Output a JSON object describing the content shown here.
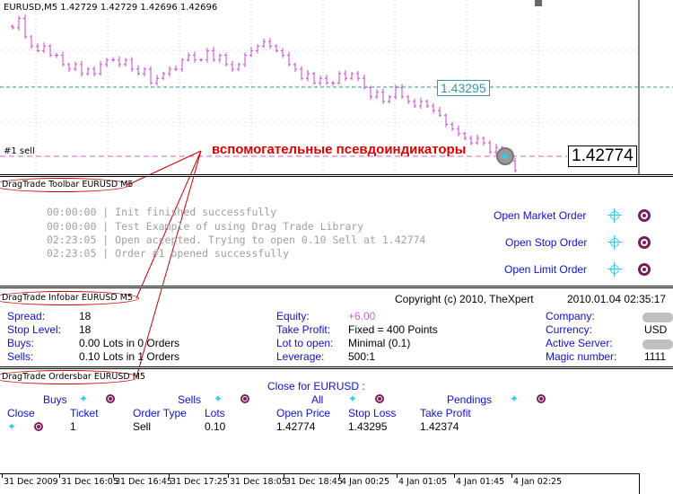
{
  "chart": {
    "header": "EURUSD,M5  1.42729 1.42729 1.42696 1.42696",
    "sell_label": "#1 sell",
    "stoploss_price": "1.43295",
    "current_price": "1.42774",
    "annotation": "вспомогательные псевдоиндикаторы",
    "colors": {
      "candles": "#cc44cc",
      "grid": "#c8c8c8",
      "stoploss_line": "#3399aa",
      "sell_line": "#cc66cc",
      "annotation": "#dd0000"
    },
    "closes": [
      1.4278,
      1.428,
      1.4276,
      1.4274,
      1.4273,
      1.4274,
      1.4272,
      1.4272,
      1.427,
      1.4269,
      1.427,
      1.4268,
      1.4269,
      1.4268,
      1.427,
      1.4271,
      1.4271,
      1.427,
      1.4271,
      1.4269,
      1.4268,
      1.4269,
      1.4266,
      1.4267,
      1.4268,
      1.4269,
      1.4269,
      1.4271,
      1.4272,
      1.4271,
      1.4271,
      1.4273,
      1.4271,
      1.4272,
      1.427,
      1.4269,
      1.427,
      1.4272,
      1.4273,
      1.4274,
      1.4275,
      1.4274,
      1.4273,
      1.4272,
      1.427,
      1.4269,
      1.4267,
      1.4268,
      1.4266,
      1.4267,
      1.4266,
      1.4266,
      1.4268,
      1.4267,
      1.4268,
      1.4267,
      1.4265,
      1.4263,
      1.4264,
      1.4262,
      1.4263,
      1.4265,
      1.4263,
      1.4262,
      1.4261,
      1.4262,
      1.4261,
      1.426,
      1.4259,
      1.4257,
      1.4256,
      1.4255,
      1.4254,
      1.4253,
      1.4254,
      1.4253,
      1.4251,
      1.4252,
      1.425,
      1.4249,
      1.4247
    ]
  },
  "toolbar": {
    "label": "DragTrade Toolbar EURUSD M5",
    "log": [
      "00:00:00 |   Init finished successfully",
      "00:00:00 |   Test Example of using Drag Trade Library",
      "02:23:05 |   Open accepted. Trying to open 0.10 Sell at 1.42774",
      "02:23:05 |   Order #1 opened successfully"
    ],
    "open_market": "Open Market Order",
    "open_stop": "Open Stop Order",
    "open_limit": "Open Limit Order"
  },
  "infobar": {
    "label": "DragTrade Infobar EURUSD M5",
    "copyright": "Copyright (c) 2010, TheXpert",
    "datetime": "2010.01.04 02:35:17",
    "spread_label": "Spread:",
    "spread": "18",
    "stoplevel_label": "Stop Level:",
    "stoplevel": "18",
    "buys_label": "Buys:",
    "buys": "0.00 Lots in 0 Orders",
    "sells_label": "Sells:",
    "sells": "0.10 Lots in 1 Orders",
    "equity_label": "Equity:",
    "equity": "+6.00",
    "tp_label": "Take Profit:",
    "tp": "Fixed = 400 Points",
    "lot_label": "Lot to open:",
    "lot": "Minimal (0.1)",
    "leverage_label": "Leverage:",
    "leverage": "500:1",
    "company_label": "Company:",
    "currency_label": "Currency:",
    "currency": "USD",
    "server_label": "Active Server:",
    "magic_label": "Magic number:",
    "magic": "1111"
  },
  "ordersbar": {
    "label": "DragTrade Ordersbar EURUSD M5",
    "close_for": "Close for EURUSD :",
    "buys": "Buys",
    "sells": "Sells",
    "all": "All",
    "pendings": "Pendings",
    "columns": [
      "Close",
      "Ticket",
      "Order Type",
      "Lots",
      "Open Price",
      "Stop Loss",
      "Take Profit"
    ],
    "row": {
      "ticket": "1",
      "type": "Sell",
      "lots": "0.10",
      "open": "1.42774",
      "sl": "1.43295",
      "tp": "1.42374"
    }
  },
  "time_axis": [
    "31 Dec 2009",
    "31 Dec 16:05",
    "31 Dec 16:45",
    "31 Dec 17:25",
    "31 Dec 18:05",
    "31 Dec 18:45",
    "4 Jan 00:25",
    "4 Jan 01:05",
    "4 Jan 01:45",
    "4 Jan 02:25"
  ]
}
